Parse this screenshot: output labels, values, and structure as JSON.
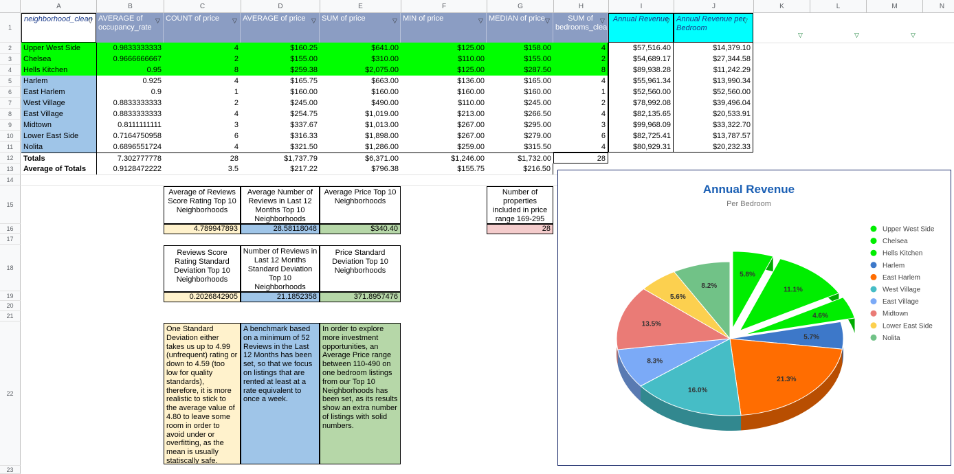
{
  "columns": [
    "A",
    "B",
    "C",
    "D",
    "E",
    "F",
    "G",
    "H",
    "I",
    "J",
    "K",
    "L",
    "M",
    "N"
  ],
  "row_numbers": [
    "1",
    "2",
    "3",
    "4",
    "5",
    "6",
    "7",
    "8",
    "9",
    "10",
    "11",
    "12",
    "13",
    "14",
    "15",
    "16",
    "17",
    "18",
    "19",
    "20",
    "21",
    "22",
    "23"
  ],
  "headers": {
    "a": "neighborhood_clean",
    "b": "AVERAGE of occupancy_rate",
    "c": "COUNT of price",
    "d": "AVERAGE of price",
    "e": "SUM of price",
    "f": "MIN of price",
    "g": "MEDIAN of price",
    "h": "SUM of bedrooms_clean",
    "i": "Annual Revenue",
    "j": "Annual Revenue per Bedroom"
  },
  "rows": [
    {
      "name": "Upper West Side",
      "occ": "0.9833333333",
      "count": "4",
      "avg": "$160.25",
      "sum": "$641.00",
      "min": "$125.00",
      "median": "$158.00",
      "beds": "4",
      "rev": "$57,516.40",
      "rpb": "$14,379.10"
    },
    {
      "name": "Chelsea",
      "occ": "0.9666666667",
      "count": "2",
      "avg": "$155.00",
      "sum": "$310.00",
      "min": "$110.00",
      "median": "$155.00",
      "beds": "2",
      "rev": "$54,689.17",
      "rpb": "$27,344.58"
    },
    {
      "name": "Hells Kitchen",
      "occ": "0.95",
      "count": "8",
      "avg": "$259.38",
      "sum": "$2,075.00",
      "min": "$125.00",
      "median": "$287.50",
      "beds": "8",
      "rev": "$89,938.28",
      "rpb": "$11,242.29"
    },
    {
      "name": "Harlem",
      "occ": "0.925",
      "count": "4",
      "avg": "$165.75",
      "sum": "$663.00",
      "min": "$136.00",
      "median": "$165.00",
      "beds": "4",
      "rev": "$55,961.34",
      "rpb": "$13,990.34"
    },
    {
      "name": "East Harlem",
      "occ": "0.9",
      "count": "1",
      "avg": "$160.00",
      "sum": "$160.00",
      "min": "$160.00",
      "median": "$160.00",
      "beds": "1",
      "rev": "$52,560.00",
      "rpb": "$52,560.00"
    },
    {
      "name": "West Village",
      "occ": "0.8833333333",
      "count": "2",
      "avg": "$245.00",
      "sum": "$490.00",
      "min": "$110.00",
      "median": "$245.00",
      "beds": "2",
      "rev": "$78,992.08",
      "rpb": "$39,496.04"
    },
    {
      "name": "East Village",
      "occ": "0.8833333333",
      "count": "4",
      "avg": "$254.75",
      "sum": "$1,019.00",
      "min": "$213.00",
      "median": "$266.50",
      "beds": "4",
      "rev": "$82,135.65",
      "rpb": "$20,533.91"
    },
    {
      "name": "Midtown",
      "occ": "0.8111111111",
      "count": "3",
      "avg": "$337.67",
      "sum": "$1,013.00",
      "min": "$267.00",
      "median": "$295.00",
      "beds": "3",
      "rev": "$99,968.09",
      "rpb": "$33,322.70"
    },
    {
      "name": "Lower East Side",
      "occ": "0.7164750958",
      "count": "6",
      "avg": "$316.33",
      "sum": "$1,898.00",
      "min": "$267.00",
      "median": "$279.00",
      "beds": "6",
      "rev": "$82,725.41",
      "rpb": "$13,787.57"
    },
    {
      "name": "Nolita",
      "occ": "0.6896551724",
      "count": "4",
      "avg": "$321.50",
      "sum": "$1,286.00",
      "min": "$259.00",
      "median": "$315.50",
      "beds": "4",
      "rev": "$80,929.31",
      "rpb": "$20,232.33"
    }
  ],
  "totals": {
    "name": "Totals",
    "occ": "7.302777778",
    "count": "28",
    "avg": "$1,737.79",
    "sum": "$6,371.00",
    "min": "$1,246.00",
    "median": "$1,732.00",
    "beds": "28"
  },
  "average_totals": {
    "name": "Average of Totals",
    "occ": "0.9128472222",
    "count": "3.5",
    "avg": "$217.22",
    "sum": "$796.38",
    "min": "$155.75",
    "median": "$216.50"
  },
  "stats": {
    "avg_reviews_label": "Average of Reviews Score Rating Top 10 Neighborhoods",
    "avg_reviews_value": "4.789947893",
    "avg_num_reviews_label": "Average Number of Reviews in Last 12 Months Top 10 Neighborhoods",
    "avg_num_reviews_value": "28.58118048",
    "avg_price_label": "Average Price Top 10 Neighborhoods",
    "avg_price_value": "$340.40",
    "num_props_label": "Number of properties included in price range 169-295",
    "num_props_value": "28",
    "sd_score_label": "Reviews Score Rating Standard Deviation Top 10 Neighborhoods",
    "sd_score_value": "0.2026842905",
    "sd_reviews_label": "Number of Reviews in Last 12 Months Standard Deviation Top 10 Neighborhoods",
    "sd_reviews_value": "21.1852358",
    "sd_price_label": "Price Standard Deviation Top 10 Neighborhoods",
    "sd_price_value": "371.8957476"
  },
  "notes": {
    "note1": "One Standard Deviation either takes us up to 4.99 (unfrequent) rating or down to 4.59 (too low for quality standards), therefore, it is more realistic to stick to the average value of 4.80 to leave some room in order to avoid under or overfitting, as the mean is usually statiscally safe.",
    "note2": "A benchmark based on a minimum of 52 Reviews in the Last 12 Months has been set, so that we focus on listings that are rented at least at a rate equivalent to once a week.",
    "note3": "In order to explore more investment opportunities, an Average Price range between 110-490 on one bedroom listings from our Top 10 Neighborhoods has been set, as its results show an extra number of listings with solid numbers."
  },
  "colors": {
    "header_blue": "#8b9dc3",
    "green": "#00ff00",
    "light_blue": "#9fc5e8",
    "cyan": "#00ffff",
    "yellow": "#fff2cc",
    "pink": "#f4cccc",
    "sage": "#b6d7a8",
    "chart_title": "#1a5fb4"
  },
  "chart_data": {
    "type": "pie",
    "title": "Annual Revenue",
    "subtitle": "Per Bedroom",
    "legend_position": "right",
    "series": [
      {
        "name": "Upper West Side",
        "value": 5.8,
        "label": "5.8%",
        "color": "#00ee00"
      },
      {
        "name": "Chelsea",
        "value": 11.1,
        "label": "11.1%",
        "color": "#00ee00"
      },
      {
        "name": "Hells Kitchen",
        "value": 4.6,
        "label": "4.6%",
        "color": "#00ee00"
      },
      {
        "name": "Harlem",
        "value": 5.7,
        "label": "5.7%",
        "color": "#3d78c9"
      },
      {
        "name": "East Harlem",
        "value": 21.3,
        "label": "21.3%",
        "color": "#ff6d01"
      },
      {
        "name": "West Village",
        "value": 16.0,
        "label": "16.0%",
        "color": "#46bdc6"
      },
      {
        "name": "East Village",
        "value": 8.3,
        "label": "8.3%",
        "color": "#7baaf7"
      },
      {
        "name": "Midtown",
        "value": 13.5,
        "label": "13.5%",
        "color": "#ea7b76"
      },
      {
        "name": "Lower East Side",
        "value": 5.6,
        "label": "5.6%",
        "color": "#fcd04f"
      },
      {
        "name": "Nolita",
        "value": 8.2,
        "label": "8.2%",
        "color": "#71c287"
      }
    ]
  }
}
